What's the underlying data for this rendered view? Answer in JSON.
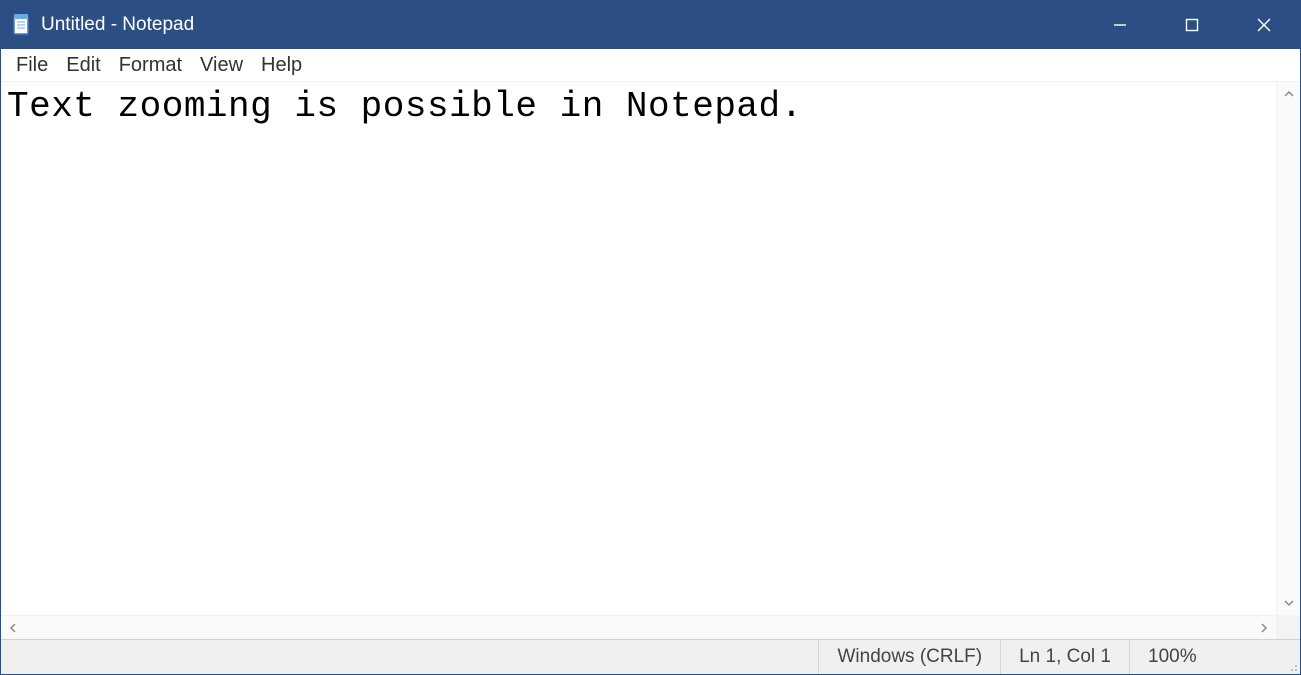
{
  "titlebar": {
    "title": "Untitled - Notepad"
  },
  "menubar": {
    "items": [
      "File",
      "Edit",
      "Format",
      "View",
      "Help"
    ]
  },
  "editor": {
    "content": "Text zooming is possible in Notepad."
  },
  "statusbar": {
    "encoding": "Windows (CRLF)",
    "position": "Ln 1, Col 1",
    "zoom": "100%"
  }
}
